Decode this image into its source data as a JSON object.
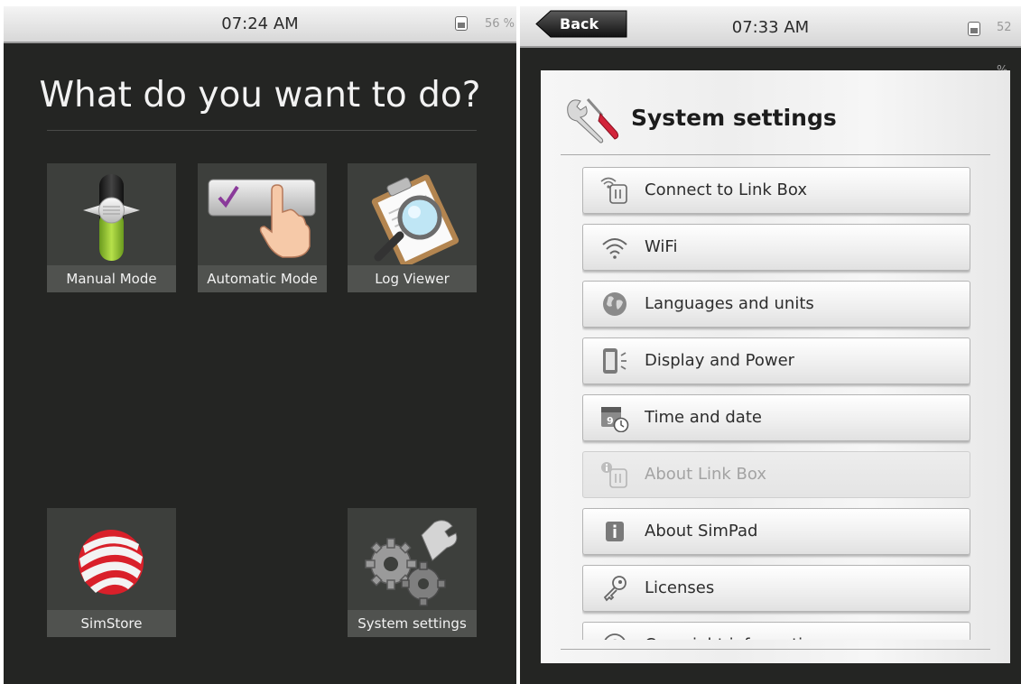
{
  "left_screen": {
    "status": {
      "time": "07:24 AM",
      "battery": "56 %"
    },
    "heading": "What do you want to do?",
    "tiles": [
      {
        "label": "Manual Mode",
        "icon": "toggle-switch-icon"
      },
      {
        "label": "Automatic Mode",
        "icon": "hand-press-check-icon"
      },
      {
        "label": "Log Viewer",
        "icon": "clipboard-magnifier-icon"
      },
      {
        "label": "SimStore",
        "icon": "simstore-logo-icon"
      },
      {
        "label": "System settings",
        "icon": "gears-wrench-icon"
      }
    ]
  },
  "right_screen": {
    "status": {
      "time": "07:33 AM",
      "battery": "52 %"
    },
    "back_label": "Back",
    "title": "System settings",
    "menu": [
      {
        "label": "Connect to Link Box",
        "icon": "link-box-signal-icon",
        "enabled": true
      },
      {
        "label": "WiFi",
        "icon": "wifi-icon",
        "enabled": true
      },
      {
        "label": "Languages and units",
        "icon": "globe-icon",
        "enabled": true
      },
      {
        "label": "Display and Power",
        "icon": "display-brightness-icon",
        "enabled": true
      },
      {
        "label": "Time and date",
        "icon": "calendar-clock-icon",
        "enabled": true
      },
      {
        "label": "About Link Box",
        "icon": "link-box-info-icon",
        "enabled": false
      },
      {
        "label": "About SimPad",
        "icon": "info-icon",
        "enabled": true
      },
      {
        "label": "Licenses",
        "icon": "key-icon",
        "enabled": true
      },
      {
        "label": "Copyright information",
        "icon": "copyright-icon",
        "enabled": true
      }
    ]
  }
}
